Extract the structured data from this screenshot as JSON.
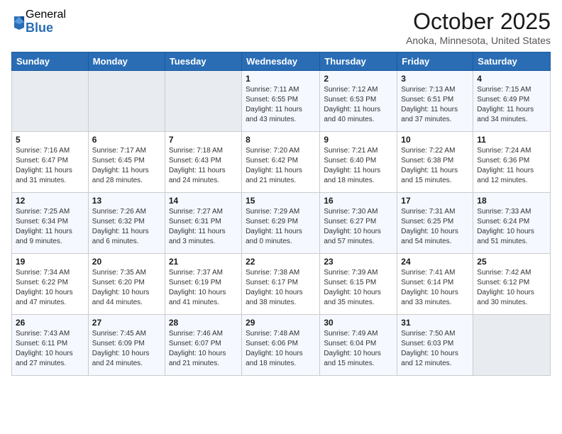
{
  "logo": {
    "general": "General",
    "blue": "Blue"
  },
  "title": "October 2025",
  "location": "Anoka, Minnesota, United States",
  "days_of_week": [
    "Sunday",
    "Monday",
    "Tuesday",
    "Wednesday",
    "Thursday",
    "Friday",
    "Saturday"
  ],
  "weeks": [
    [
      {
        "day": "",
        "info": ""
      },
      {
        "day": "",
        "info": ""
      },
      {
        "day": "",
        "info": ""
      },
      {
        "day": "1",
        "info": "Sunrise: 7:11 AM\nSunset: 6:55 PM\nDaylight: 11 hours\nand 43 minutes."
      },
      {
        "day": "2",
        "info": "Sunrise: 7:12 AM\nSunset: 6:53 PM\nDaylight: 11 hours\nand 40 minutes."
      },
      {
        "day": "3",
        "info": "Sunrise: 7:13 AM\nSunset: 6:51 PM\nDaylight: 11 hours\nand 37 minutes."
      },
      {
        "day": "4",
        "info": "Sunrise: 7:15 AM\nSunset: 6:49 PM\nDaylight: 11 hours\nand 34 minutes."
      }
    ],
    [
      {
        "day": "5",
        "info": "Sunrise: 7:16 AM\nSunset: 6:47 PM\nDaylight: 11 hours\nand 31 minutes."
      },
      {
        "day": "6",
        "info": "Sunrise: 7:17 AM\nSunset: 6:45 PM\nDaylight: 11 hours\nand 28 minutes."
      },
      {
        "day": "7",
        "info": "Sunrise: 7:18 AM\nSunset: 6:43 PM\nDaylight: 11 hours\nand 24 minutes."
      },
      {
        "day": "8",
        "info": "Sunrise: 7:20 AM\nSunset: 6:42 PM\nDaylight: 11 hours\nand 21 minutes."
      },
      {
        "day": "9",
        "info": "Sunrise: 7:21 AM\nSunset: 6:40 PM\nDaylight: 11 hours\nand 18 minutes."
      },
      {
        "day": "10",
        "info": "Sunrise: 7:22 AM\nSunset: 6:38 PM\nDaylight: 11 hours\nand 15 minutes."
      },
      {
        "day": "11",
        "info": "Sunrise: 7:24 AM\nSunset: 6:36 PM\nDaylight: 11 hours\nand 12 minutes."
      }
    ],
    [
      {
        "day": "12",
        "info": "Sunrise: 7:25 AM\nSunset: 6:34 PM\nDaylight: 11 hours\nand 9 minutes."
      },
      {
        "day": "13",
        "info": "Sunrise: 7:26 AM\nSunset: 6:32 PM\nDaylight: 11 hours\nand 6 minutes."
      },
      {
        "day": "14",
        "info": "Sunrise: 7:27 AM\nSunset: 6:31 PM\nDaylight: 11 hours\nand 3 minutes."
      },
      {
        "day": "15",
        "info": "Sunrise: 7:29 AM\nSunset: 6:29 PM\nDaylight: 11 hours\nand 0 minutes."
      },
      {
        "day": "16",
        "info": "Sunrise: 7:30 AM\nSunset: 6:27 PM\nDaylight: 10 hours\nand 57 minutes."
      },
      {
        "day": "17",
        "info": "Sunrise: 7:31 AM\nSunset: 6:25 PM\nDaylight: 10 hours\nand 54 minutes."
      },
      {
        "day": "18",
        "info": "Sunrise: 7:33 AM\nSunset: 6:24 PM\nDaylight: 10 hours\nand 51 minutes."
      }
    ],
    [
      {
        "day": "19",
        "info": "Sunrise: 7:34 AM\nSunset: 6:22 PM\nDaylight: 10 hours\nand 47 minutes."
      },
      {
        "day": "20",
        "info": "Sunrise: 7:35 AM\nSunset: 6:20 PM\nDaylight: 10 hours\nand 44 minutes."
      },
      {
        "day": "21",
        "info": "Sunrise: 7:37 AM\nSunset: 6:19 PM\nDaylight: 10 hours\nand 41 minutes."
      },
      {
        "day": "22",
        "info": "Sunrise: 7:38 AM\nSunset: 6:17 PM\nDaylight: 10 hours\nand 38 minutes."
      },
      {
        "day": "23",
        "info": "Sunrise: 7:39 AM\nSunset: 6:15 PM\nDaylight: 10 hours\nand 35 minutes."
      },
      {
        "day": "24",
        "info": "Sunrise: 7:41 AM\nSunset: 6:14 PM\nDaylight: 10 hours\nand 33 minutes."
      },
      {
        "day": "25",
        "info": "Sunrise: 7:42 AM\nSunset: 6:12 PM\nDaylight: 10 hours\nand 30 minutes."
      }
    ],
    [
      {
        "day": "26",
        "info": "Sunrise: 7:43 AM\nSunset: 6:11 PM\nDaylight: 10 hours\nand 27 minutes."
      },
      {
        "day": "27",
        "info": "Sunrise: 7:45 AM\nSunset: 6:09 PM\nDaylight: 10 hours\nand 24 minutes."
      },
      {
        "day": "28",
        "info": "Sunrise: 7:46 AM\nSunset: 6:07 PM\nDaylight: 10 hours\nand 21 minutes."
      },
      {
        "day": "29",
        "info": "Sunrise: 7:48 AM\nSunset: 6:06 PM\nDaylight: 10 hours\nand 18 minutes."
      },
      {
        "day": "30",
        "info": "Sunrise: 7:49 AM\nSunset: 6:04 PM\nDaylight: 10 hours\nand 15 minutes."
      },
      {
        "day": "31",
        "info": "Sunrise: 7:50 AM\nSunset: 6:03 PM\nDaylight: 10 hours\nand 12 minutes."
      },
      {
        "day": "",
        "info": ""
      }
    ]
  ]
}
